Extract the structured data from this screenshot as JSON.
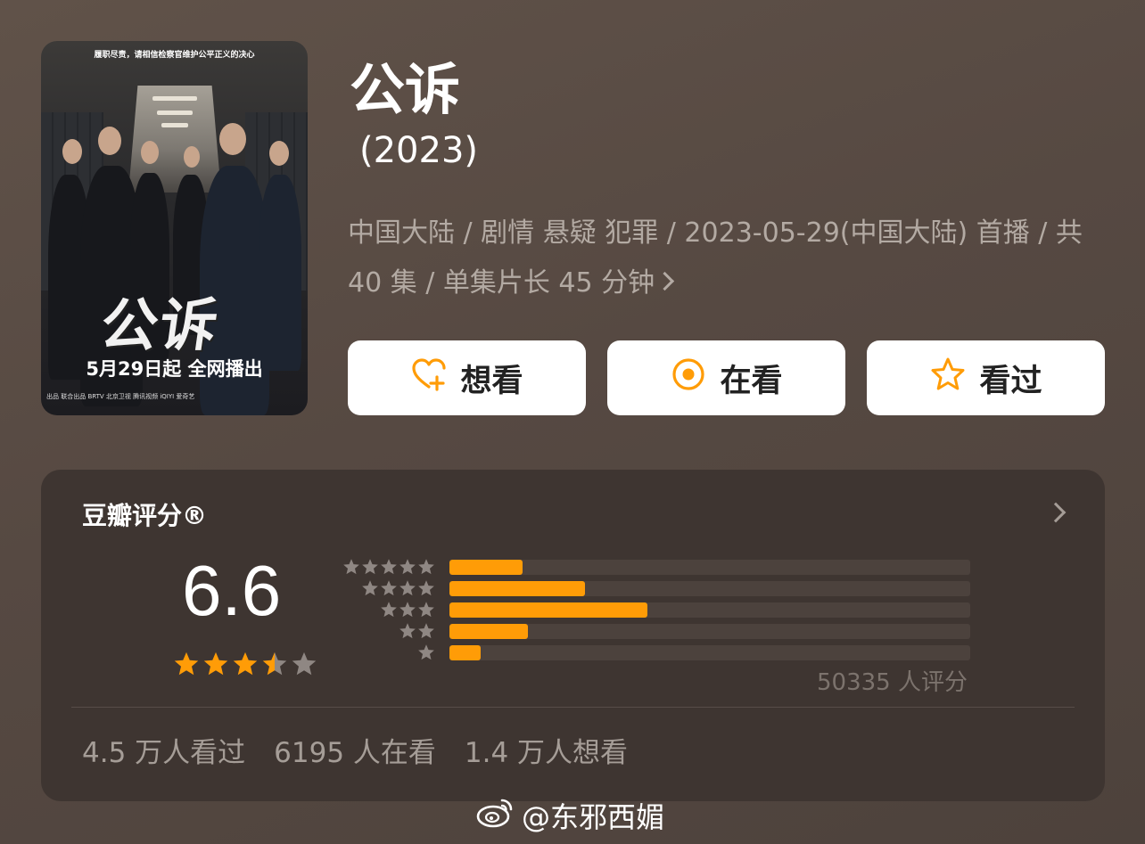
{
  "poster": {
    "tagline": "履职尽责，请相信检察官维护公平正义的决心",
    "title": "公诉",
    "release": "5月29日起 全网播出",
    "credits": "出品  联合出品  BRTV 北京卫视  腾讯视频  iQIYI 爱奇艺"
  },
  "header": {
    "title": "公诉",
    "year": "(2023)",
    "meta": "中国大陆 / 剧情 悬疑 犯罪 / 2023-05-29(中国大陆) 首播 / 共 40 集 / 单集片长 45 分钟"
  },
  "actions": {
    "want_label": "想看",
    "watching_label": "在看",
    "watched_label": "看过"
  },
  "rating": {
    "label": "豆瓣评分®",
    "score": "6.6",
    "stars_value": 3.5,
    "distribution": [
      {
        "stars": 5,
        "fraction": 0.14
      },
      {
        "stars": 4,
        "fraction": 0.26
      },
      {
        "stars": 3,
        "fraction": 0.38
      },
      {
        "stars": 2,
        "fraction": 0.15
      },
      {
        "stars": 1,
        "fraction": 0.06
      }
    ],
    "count": "50335 人评分",
    "stats": {
      "watched": "4.5 万人看过",
      "watching": "6195 人在看",
      "want": "1.4 万人想看"
    }
  },
  "colors": {
    "accent": "#ff9c07",
    "card_bg": "#3e3531",
    "page_bg": "#564942"
  },
  "watermark": "@东邪西媚"
}
